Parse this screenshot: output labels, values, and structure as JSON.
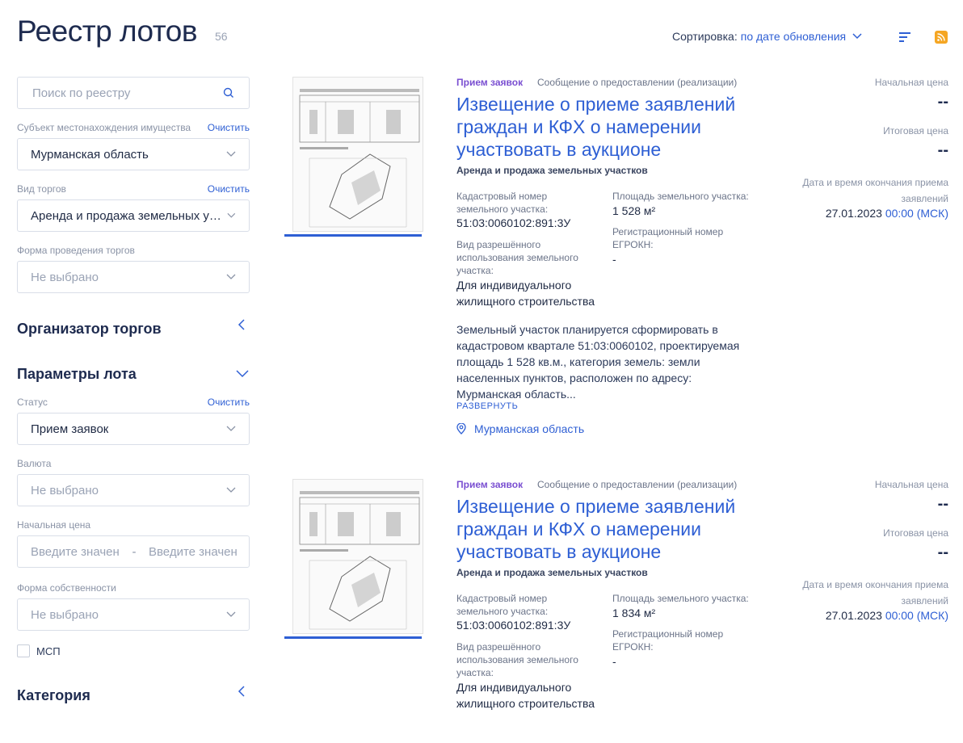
{
  "header": {
    "title": "Реестр лотов",
    "count": "56",
    "sort_label": "Сортировка:",
    "sort_value": "по дате обновления"
  },
  "sidebar": {
    "search_placeholder": "Поиск по реестру",
    "clear_label": "Очистить",
    "region": {
      "label": "Субъект местонахождения имущества",
      "value": "Мурманская область"
    },
    "auction_type": {
      "label": "Вид торгов",
      "value": "Аренда и продажа земельных участков"
    },
    "auction_form": {
      "label": "Форма проведения торгов",
      "value": "Не выбрано"
    },
    "organizer_title": "Организатор торгов",
    "lot_params_title": "Параметры лота",
    "status": {
      "label": "Статус",
      "value": "Прием заявок"
    },
    "currency": {
      "label": "Валюта",
      "value": "Не выбрано"
    },
    "start_price": {
      "label": "Начальная цена",
      "from_placeholder": "Введите значение",
      "to_placeholder": "Введите значение",
      "dash": "-"
    },
    "ownership": {
      "label": "Форма собственности",
      "value": "Не выбрано"
    },
    "msp_label": "МСП",
    "category_title": "Категория"
  },
  "lots": [
    {
      "status": "Прием заявок",
      "type": "Сообщение о предоставлении (реализации)",
      "title": "Извещение о приеме заявлений граждан и КФХ о намерении участвовать в аукционе",
      "category": "Аренда и продажа земельных участков",
      "cadastral_label": "Кадастровый номер земельного участка:",
      "cadastral_value": "51:03:0060102:891:3У",
      "area_label": "Площадь земельного участка:",
      "area_value": "1 528 м²",
      "usage_label": "Вид разрешённого использования земельного участка:",
      "usage_value": "Для индивидуального жилищного строительства",
      "reg_label": "Регистрационный номер ЕГРОКН:",
      "reg_value": "-",
      "description": "Земельный участок планируется сформировать в кадастровом квартале 51:03:0060102, проектируемая площадь 1 528 кв.м., категория земель: земли населенных пунктов, расположен по адресу: Мурманская область...",
      "expand_label": "РАЗВЕРНУТЬ",
      "location": "Мурманская область",
      "start_price_label": "Начальная цена",
      "start_price_value": "--",
      "final_price_label": "Итоговая цена",
      "final_price_value": "--",
      "deadline_label": "Дата и время окончания приема заявлений",
      "deadline_date": "27.01.2023",
      "deadline_time": "00:00 (МСК)"
    },
    {
      "status": "Прием заявок",
      "type": "Сообщение о предоставлении (реализации)",
      "title": "Извещение о приеме заявлений граждан и КФХ о намерении участвовать в аукционе",
      "category": "Аренда и продажа земельных участков",
      "cadastral_label": "Кадастровый номер земельного участка:",
      "cadastral_value": "51:03:0060102:891:3У",
      "area_label": "Площадь земельного участка:",
      "area_value": "1 834 м²",
      "usage_label": "Вид разрешённого использования земельного участка:",
      "usage_value": "Для индивидуального жилищного строительства",
      "reg_label": "Регистрационный номер ЕГРОКН:",
      "reg_value": "-",
      "start_price_label": "Начальная цена",
      "start_price_value": "--",
      "final_price_label": "Итоговая цена",
      "final_price_value": "--",
      "deadline_label": "Дата и время окончания приема заявлений",
      "deadline_date": "27.01.2023",
      "deadline_time": "00:00 (МСК)"
    }
  ]
}
